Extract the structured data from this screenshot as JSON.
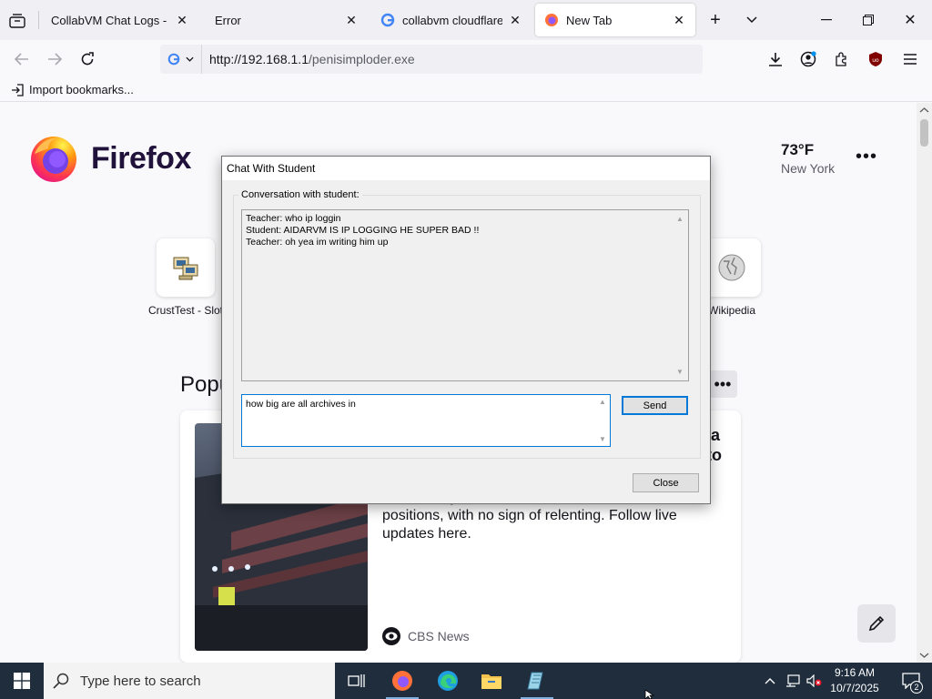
{
  "browser": {
    "tabs": [
      {
        "title": "CollabVM Chat Logs - Elija"
      },
      {
        "title": "Error"
      },
      {
        "title": "collabvm cloudflare - G"
      },
      {
        "title": "New Tab"
      }
    ],
    "url": {
      "host": "http://192.168.1.1",
      "path": "/penisimploder.exe"
    },
    "bookmarks_import_label": "Import bookmarks..."
  },
  "newtab": {
    "brand": "Firefox",
    "weather": {
      "temp": "73°F",
      "city": "New York"
    },
    "shortcuts": [
      {
        "label": "CrustTest - Slot"
      },
      {
        "label": "Wikipedia"
      }
    ],
    "popular_title": "Popu",
    "story": {
      "headline_line1": "ia",
      "headline_line2": "to",
      "description": "on Tuesday as both sides remained locked in their positions, with no sign of relenting. Follow live updates here.",
      "source": "CBS News"
    }
  },
  "dialog": {
    "title": "Chat With Student",
    "group_label": "Conversation with student:",
    "conversation": [
      "Teacher: who ip loggin",
      "Student: AIDARVM IS IP LOGGING HE SUPER BAD !!",
      "Teacher: oh yea im writing him up"
    ],
    "input_value": "how big are all archives in",
    "send_label": "Send",
    "close_label": "Close"
  },
  "taskbar": {
    "search_placeholder": "Type here to search",
    "time": "9:16 AM",
    "date": "10/7/2025",
    "notification_count": "2"
  },
  "colors": {
    "dialog_focus": "#0078d7",
    "taskbar_bg": "#1f2d3d",
    "firefox_orange": "#ff7139"
  }
}
